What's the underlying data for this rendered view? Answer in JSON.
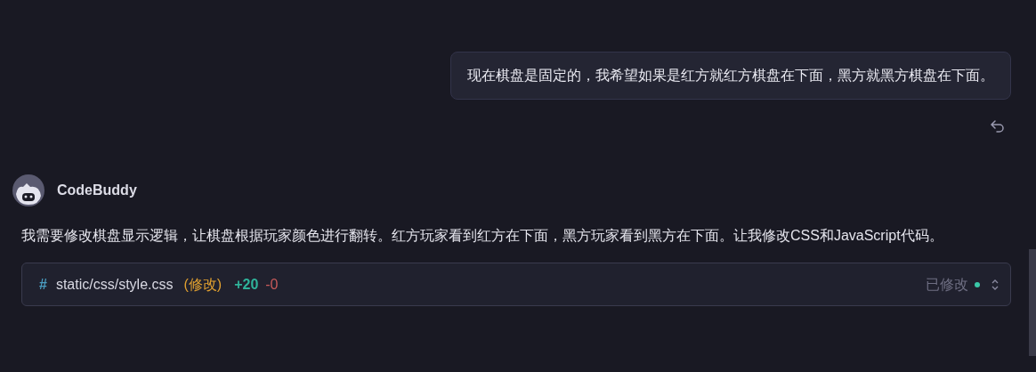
{
  "user_message": {
    "text": "现在棋盘是固定的，我希望如果是红方就红方棋盘在下面，黑方就黑方棋盘在下面。"
  },
  "assistant": {
    "name": "CodeBuddy",
    "text": "我需要修改棋盘显示逻辑，让棋盘根据玩家颜色进行翻转。红方玩家看到红方在下面，黑方玩家看到黑方在下面。让我修改CSS和JavaScript代码。"
  },
  "file_change": {
    "icon": "#",
    "path": "static/css/style.css",
    "action": "(修改)",
    "added": "+20",
    "removed": "-0",
    "status": "已修改",
    "expanded": false
  }
}
